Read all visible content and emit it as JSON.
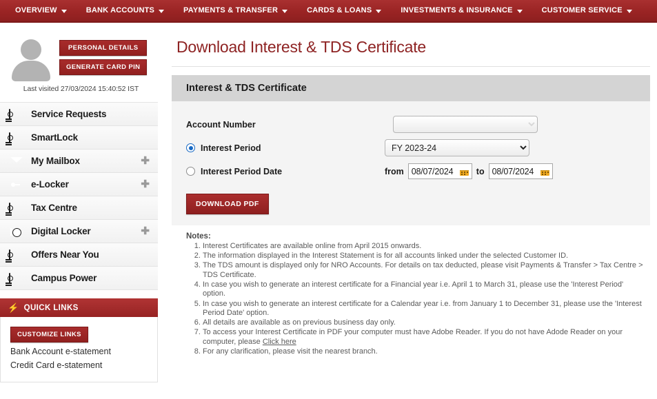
{
  "topnav": {
    "items": [
      {
        "label": "OVERVIEW",
        "has_caret": true
      },
      {
        "label": "BANK ACCOUNTS",
        "has_caret": true
      },
      {
        "label": "PAYMENTS & TRANSFER",
        "has_caret": true
      },
      {
        "label": "CARDS & LOANS",
        "has_caret": true
      },
      {
        "label": "INVESTMENTS & INSURANCE",
        "has_caret": true
      },
      {
        "label": "CUSTOMER SERVICE",
        "has_caret": true
      }
    ]
  },
  "sidebar": {
    "personal_details_label": "PERSONAL DETAILS",
    "generate_card_pin_label": "GENERATE CARD PIN",
    "last_visited": "Last visited 27/03/2024 15:40:52 IST",
    "menu": [
      {
        "label": "Service Requests",
        "icon": "cash-icon",
        "expandable": false
      },
      {
        "label": "SmartLock",
        "icon": "cash-icon",
        "expandable": false
      },
      {
        "label": "My Mailbox",
        "icon": "envelope-icon",
        "expandable": true
      },
      {
        "label": "e-Locker",
        "icon": "key-icon",
        "expandable": true
      },
      {
        "label": "Tax Centre",
        "icon": "cash-icon",
        "expandable": false
      },
      {
        "label": "Digital Locker",
        "icon": "safe-icon",
        "expandable": true
      },
      {
        "label": "Offers Near You",
        "icon": "cash-icon",
        "expandable": false
      },
      {
        "label": "Campus Power",
        "icon": "cash-icon",
        "expandable": false
      }
    ],
    "quick_links": {
      "header": "QUICK LINKS",
      "bolt_icon": "lightning-bolt-icon",
      "customize_label": "CUSTOMIZE LINKS",
      "links": [
        "Bank Account e-statement",
        "Credit Card e-statement"
      ]
    }
  },
  "main": {
    "page_title": "Download Interest & TDS Certificate",
    "panel_title": "Interest & TDS Certificate",
    "form": {
      "account_number_label": "Account Number",
      "account_number_value": "",
      "interest_period_label": "Interest Period",
      "interest_period_selected": true,
      "interest_period_value": "FY 2023-24",
      "interest_period_date_label": "Interest Period Date",
      "interest_period_date_selected": false,
      "from_label": "from",
      "from_value": "08/07/2024",
      "to_label": "to",
      "to_value": "08/07/2024",
      "calendar_icon": "calendar-icon",
      "download_label": "DOWNLOAD PDF"
    },
    "notes": {
      "title": "Notes:",
      "items": [
        "Interest Certificates are available online from April 2015 onwards.",
        "The information displayed in the Interest Statement is for all accounts linked under the selected Customer ID.",
        "The TDS amount is displayed only for NRO Accounts. For details on tax deducted, please visit Payments & Transfer > Tax Centre > TDS Certificate.",
        "In case you wish to generate an interest certificate for a Financial year i.e. April 1 to March 31, please use the 'Interest Period' option.",
        "In case you wish to generate an interest certificate for a Calendar year i.e. from January 1 to December 31, please use the 'Interest Period Date' option.",
        "All details are available as on previous business day only.",
        "To access your Interest Certificate in PDF your computer must have Adobe Reader. If you do not have Adode Reader on your computer, please ",
        "For any clarification, please visit the nearest branch."
      ],
      "link_text": "Click here"
    }
  },
  "colors": {
    "brand_red": "#9a2424",
    "title_red": "#8e2323",
    "panel_header_gray": "#d4d4d4",
    "panel_body_gray": "#f4f4f4",
    "radio_blue": "#1769c4",
    "calendar_orange": "#f0a81e"
  }
}
